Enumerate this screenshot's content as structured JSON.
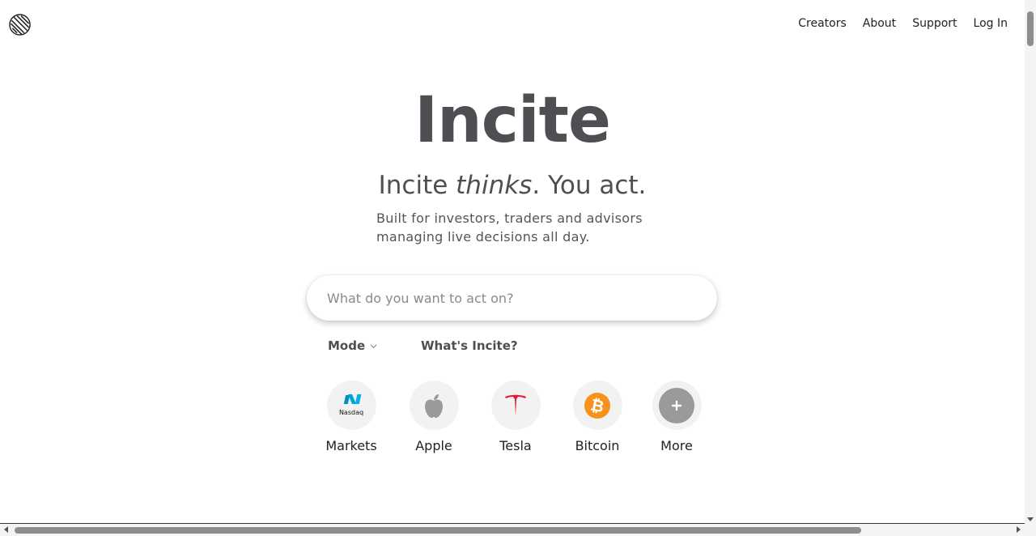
{
  "nav": {
    "items": [
      {
        "label": "Creators"
      },
      {
        "label": "About"
      },
      {
        "label": "Support"
      },
      {
        "label": "Log In"
      }
    ]
  },
  "hero": {
    "title": "Incite",
    "tagline_prefix": "Incite ",
    "tagline_em": "thinks",
    "tagline_suffix": ". You act.",
    "subline_1": "Built for investors, traders and advisors",
    "subline_2": "managing live decisions all day."
  },
  "search": {
    "value": "",
    "placeholder": "What do you want to act on?"
  },
  "controls": {
    "mode_label": "Mode",
    "whats_label": "What's Incite?"
  },
  "quick_links": [
    {
      "label": "Markets",
      "icon": "nasdaq-icon",
      "icon_text": "Nasdaq",
      "color": "#00a3d9"
    },
    {
      "label": "Apple",
      "icon": "apple-icon",
      "color": "#9a9a9a"
    },
    {
      "label": "Tesla",
      "icon": "tesla-icon",
      "color": "#e31937"
    },
    {
      "label": "Bitcoin",
      "icon": "bitcoin-icon",
      "color": "#f7931a"
    },
    {
      "label": "More",
      "icon": "plus-icon",
      "color": "#9a9a9a"
    }
  ],
  "colors": {
    "title": "#4d4f53",
    "text": "#222222"
  }
}
